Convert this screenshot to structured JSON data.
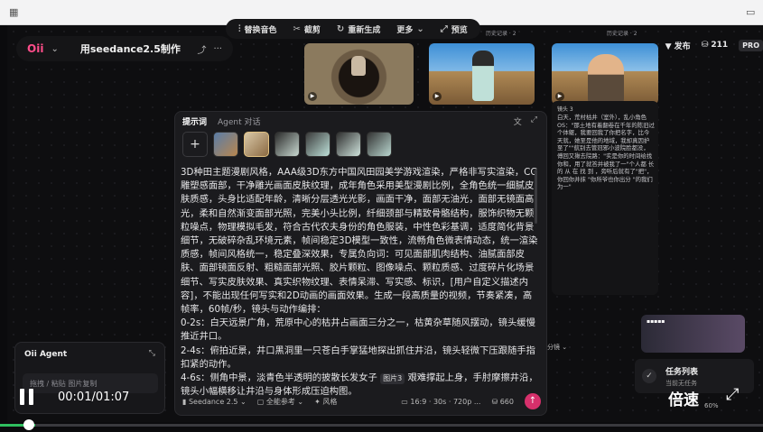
{
  "window": {
    "grid_icon": "grid-icon",
    "folder_icon": "folder-icon"
  },
  "toolbar": {
    "items": [
      {
        "icon": "waveform-icon",
        "glyph": "⫶",
        "label": "替换音色"
      },
      {
        "icon": "scissors-icon",
        "glyph": "✂",
        "label": "截剪"
      },
      {
        "icon": "refresh-icon",
        "glyph": "↻",
        "label": "重新生成"
      },
      {
        "icon": "chevron-down-icon",
        "glyph": "⌄",
        "label": "更多"
      },
      {
        "icon": "expand-icon",
        "glyph": "⤢",
        "label": "预览"
      }
    ]
  },
  "project": {
    "logo": "Oii",
    "caret": "⌄",
    "title": "用seedance2.5制作",
    "share": "⤴",
    "more": "···"
  },
  "header_right": {
    "publish_label": "发布",
    "publish_icon": "filter-icon",
    "credits": "211",
    "plan": "PRO"
  },
  "thumbs": {
    "captions": [
      "历史记录 · 2",
      "历史记录 · 2"
    ]
  },
  "prompt_panel": {
    "tab_prompt": "提示词",
    "tab_agent": "Agent 对话",
    "icons": [
      "translate-icon",
      "expand-icon"
    ],
    "icon_glyphs": [
      "文",
      "⤢"
    ],
    "add_label": "+",
    "paragraphs": [
      "3D种田主题漫剧风格，AAA级3D东方中国风田园美学游戏渲染，严格非写实渲染，CG雕塑感面部，干净雕光画面皮肤纹理，成年角色采用美型漫剧比例，全角色统一细腻皮肤质感，头身比适配年龄，清晰分层透光光影，画面干净，面部无油光，面部无镜面高光，柔和自然渐变面部光照，完美小头比例，纤细颈部与精致骨骼结构，服饰织物无颗粒噪点，物理模拟毛发，符合古代农夫身份的角色服装，中性色彩基调，适度简化背景细节，无破碎杂乱环境元素，帧间稳定3D模型一致性，流畅角色微表情动态，统一渲染质感，帧间风格统一，稳定叠深效果，专属负向词：可见面部肌肉结构、油腻面部皮肤、面部镜面反射、粗糙面部光照、胶片颗粒、图像噪点、颗粒质感、过度碎片化场景细节、写实皮肤效果、真实织物纹理、表情呆滞、写实感、标识，[用户自定义描述内容]，不能出现任何写实和2D动画的画面效果。生成一段高质量的视频，节奏紧凑，高帧率，60帧/秒，镜头与动作编排：",
      "0-2s：白天远景广角，荒原中心的枯井占画面三分之一，枯黄杂草随风摆动，镜头缓慢推近井口。",
      "2-4s：俯拍近景，井口黑洞里一只苍白手掌猛地探出抓住井沿，镜头轻微下压跟随手指扣紧的动作。"
    ],
    "line4_prefix": "4-6s：侧角中景，淡青色半透明的披散长发女子",
    "chip": "图片3",
    "line4_suffix": "艰难撑起上身，手肘摩擦井沿，镜头小幅横移让井沿与身体形成压迫构图。",
    "footer": {
      "model": "Seedance 2.5",
      "ref_mode": "全能参考",
      "style": "风格",
      "spec": "16:9 · 30s · 720p ...",
      "cost": "660",
      "send": "↑"
    }
  },
  "side_card": {
    "label": "镜头 3",
    "text": "白天，荒村枯井（室外），乱小角色OS：\"那土地有着翻卷在千年的陈旧过个体躯，我要回我了你把名字，比今天就，她至是他的地域，我却真因护至了\"\"航别去管冠邪小波院脸都没，傅回又揪去院路：\"实是你的时间给找你和，用了就答并被我了一\"个人都 长 的 从 在 找 到 ，旁听后就有了\"把\"，你回你并抹 \"你所爷也你出分 \"的我们为一\""
  },
  "side_badge": "分镜 ⌄",
  "pink_card": "▪▪▪▪▪",
  "agent": {
    "title": "Oii Agent",
    "expand": "⤡",
    "placeholder": "拖拽 / 粘贴  图片复制"
  },
  "tasks": {
    "title": "任务列表",
    "subtitle": "当前无任务",
    "check": "✓"
  },
  "player": {
    "time": "00:01/01:07",
    "speed_label": "倍速",
    "fullscreen_glyph": "⤢",
    "zoom": "60%",
    "progress": 0.015
  },
  "colors": {
    "accent": "#d6306b",
    "progress": "#2fbf5f"
  }
}
